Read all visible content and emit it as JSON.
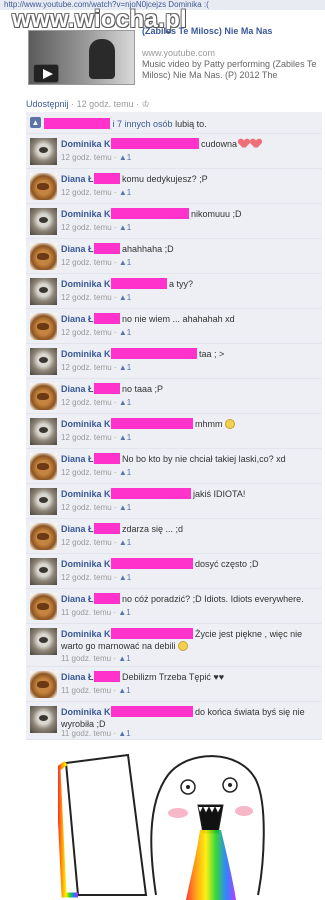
{
  "browser": {
    "url_bar": "http://www.youtube.com/watch?v=njoN0jcejzs Dominika :("
  },
  "watermark": "www.wiocha.pl",
  "video": {
    "title": "(Zabiles Te Milosc) Nie Ma Nas",
    "domain": "www.youtube.com",
    "description": "Music video by Patty performing (Zabiles Te Milosc) Nie Ma Nas. (P) 2012 The"
  },
  "share": {
    "share_label": "Udostępnij",
    "time": "12 godz. temu",
    "dot": "·"
  },
  "likes": {
    "text_middle": "i 7 innych osób",
    "text_end": "lubią to."
  },
  "comment_meta": {
    "like_count": "1"
  },
  "comments": [
    {
      "author": "Dominika K",
      "text": "cudowna",
      "time": "12 godz. temu",
      "avatar": "cat-avatar",
      "extra": "hearts"
    },
    {
      "author": "Diana Ł",
      "text": "komu dedykujesz? ;P",
      "time": "12 godz. temu",
      "avatar": "food-avatar"
    },
    {
      "author": "Dominika K",
      "text": "nikomuuu ;D",
      "time": "12 godz. temu",
      "avatar": "cat-avatar"
    },
    {
      "author": "Diana Ł",
      "text": "ahahhaha ;D",
      "time": "12 godz. temu",
      "avatar": "food-avatar"
    },
    {
      "author": "Dominika K",
      "text": "a tyy?",
      "time": "12 godz. temu",
      "avatar": "cat-avatar"
    },
    {
      "author": "Diana Ł",
      "text": "no nie wiem ... ahahahah xd",
      "time": "12 godz. temu",
      "avatar": "food-avatar"
    },
    {
      "author": "Dominika K",
      "text": "taa ; >",
      "time": "12 godz. temu",
      "avatar": "cat-avatar"
    },
    {
      "author": "Diana Ł",
      "text": "no taaa ;P",
      "time": "12 godz. temu",
      "avatar": "food-avatar"
    },
    {
      "author": "Dominika K",
      "text": "mhmm",
      "time": "12 godz. temu",
      "avatar": "cat-avatar",
      "extra": "face"
    },
    {
      "author": "Diana Ł",
      "text": "No bo kto by nie chciał takiej laski,co? xd",
      "time": "12 godz. temu",
      "avatar": "food-avatar"
    },
    {
      "author": "Dominika K",
      "text": "jakiś IDIOTA!",
      "time": "12 godz. temu",
      "avatar": "cat-avatar"
    },
    {
      "author": "Diana Ł",
      "text": "zdarza się ... ;d",
      "time": "12 godz. temu",
      "avatar": "food-avatar"
    },
    {
      "author": "Dominika K",
      "text": "dosyć często ;D",
      "time": "12 godz. temu",
      "avatar": "cat-avatar"
    },
    {
      "author": "Diana Ł",
      "text": "no cóż poradzić? ;D Idiots. Idiots everywhere.",
      "time": "11 godz. temu",
      "avatar": "food-avatar"
    },
    {
      "author": "Dominika K",
      "text": "Życie jest piękne , więc nie warto go marnować na debili",
      "time": "11 godz. temu",
      "avatar": "cat-avatar",
      "extra": "face"
    },
    {
      "author": "Diana Ł",
      "text": "Debilizm Trzeba Tępić ♥♥",
      "time": "11 godz. temu",
      "avatar": "food-avatar"
    },
    {
      "author": "Dominika K",
      "text": "do końca świata byś się nie wyrobiła ;D",
      "time": "11 godz. temu",
      "avatar": "cat-avatar"
    }
  ]
}
